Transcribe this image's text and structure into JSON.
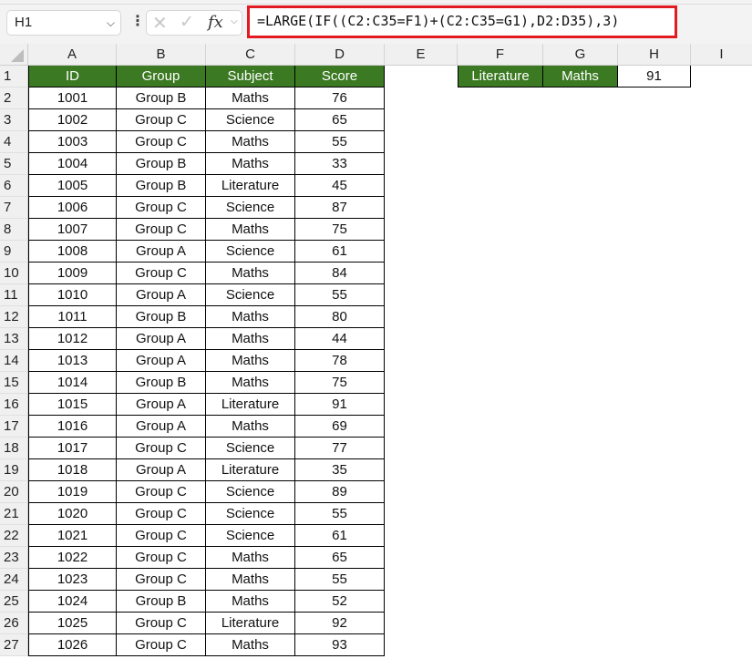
{
  "formula_bar": {
    "name_box": "H1",
    "name_box_chevron_icon": "⌵",
    "more_icon": "⋮",
    "cancel_icon": "✕",
    "enter_icon": "✓",
    "fx_label": "fx",
    "fx_chevron_icon": "⌵",
    "formula": "=LARGE(IF((C2:C35=F1)+(C2:C35=G1),D2:D35),3)"
  },
  "columns": [
    "A",
    "B",
    "C",
    "D",
    "E",
    "F",
    "G",
    "H",
    "I"
  ],
  "colors": {
    "header_fill": "#3b7a22",
    "header_text": "#ffffff",
    "formula_highlight": "#e21b23"
  },
  "table": {
    "headers": [
      "ID",
      "Group",
      "Subject",
      "Score"
    ],
    "rows": [
      [
        "1001",
        "Group B",
        "Maths",
        "76"
      ],
      [
        "1002",
        "Group C",
        "Science",
        "65"
      ],
      [
        "1003",
        "Group C",
        "Maths",
        "55"
      ],
      [
        "1004",
        "Group B",
        "Maths",
        "33"
      ],
      [
        "1005",
        "Group B",
        "Literature",
        "45"
      ],
      [
        "1006",
        "Group C",
        "Science",
        "87"
      ],
      [
        "1007",
        "Group C",
        "Maths",
        "75"
      ],
      [
        "1008",
        "Group A",
        "Science",
        "61"
      ],
      [
        "1009",
        "Group C",
        "Maths",
        "84"
      ],
      [
        "1010",
        "Group A",
        "Science",
        "55"
      ],
      [
        "1011",
        "Group B",
        "Maths",
        "80"
      ],
      [
        "1012",
        "Group A",
        "Maths",
        "44"
      ],
      [
        "1013",
        "Group A",
        "Maths",
        "78"
      ],
      [
        "1014",
        "Group B",
        "Maths",
        "75"
      ],
      [
        "1015",
        "Group A",
        "Literature",
        "91"
      ],
      [
        "1016",
        "Group A",
        "Maths",
        "69"
      ],
      [
        "1017",
        "Group C",
        "Science",
        "77"
      ],
      [
        "1018",
        "Group A",
        "Literature",
        "35"
      ],
      [
        "1019",
        "Group C",
        "Science",
        "89"
      ],
      [
        "1020",
        "Group C",
        "Science",
        "55"
      ],
      [
        "1021",
        "Group C",
        "Science",
        "61"
      ],
      [
        "1022",
        "Group C",
        "Maths",
        "65"
      ],
      [
        "1023",
        "Group C",
        "Maths",
        "55"
      ],
      [
        "1024",
        "Group B",
        "Maths",
        "52"
      ],
      [
        "1025",
        "Group C",
        "Literature",
        "92"
      ],
      [
        "1026",
        "Group C",
        "Maths",
        "93"
      ]
    ]
  },
  "criteria": {
    "f1": "Literature",
    "g1": "Maths",
    "h1": "91"
  },
  "row_numbers": [
    "1",
    "2",
    "3",
    "4",
    "5",
    "6",
    "7",
    "8",
    "9",
    "10",
    "11",
    "12",
    "13",
    "14",
    "15",
    "16",
    "17",
    "18",
    "19",
    "20",
    "21",
    "22",
    "23",
    "24",
    "25",
    "26",
    "27"
  ]
}
